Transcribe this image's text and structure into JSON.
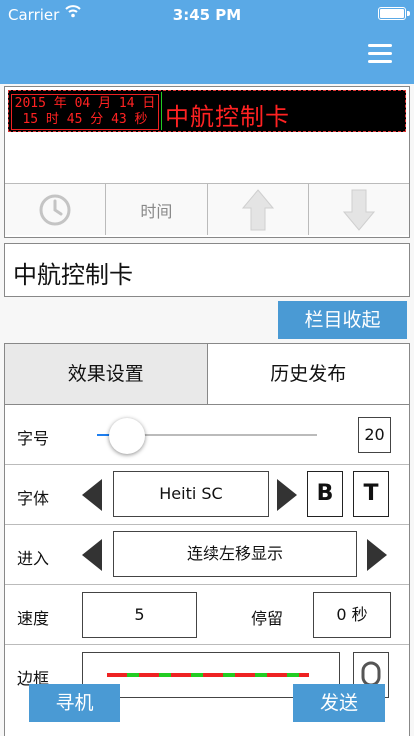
{
  "status_bar": {
    "carrier": "Carrier",
    "time": "3:45 PM"
  },
  "header": {
    "menu_icon": "hamburger-menu-icon"
  },
  "preview": {
    "date_line1": "2015 年 04 月 14 日",
    "date_line2": "15 时 45 分 43 秒",
    "led_title": "中航控制卡",
    "tools": [
      {
        "icon": "clock-icon"
      },
      {
        "label": "时间"
      },
      {
        "icon": "arrow-up-icon"
      },
      {
        "icon": "arrow-down-icon"
      }
    ]
  },
  "text_input": {
    "value": "中航控制卡"
  },
  "collapse_button": "栏目收起",
  "tabs": [
    {
      "label": "效果设置",
      "active": true
    },
    {
      "label": "历史发布",
      "active": false
    }
  ],
  "settings": {
    "font_size": {
      "label": "字号",
      "value": "20",
      "slider_fraction": 0.1
    },
    "font_face": {
      "label": "字体",
      "value": "Heiti SC",
      "bold_label": "B",
      "t_label": "T"
    },
    "enter": {
      "label": "进入",
      "value": "连续左移显示"
    },
    "speed": {
      "label": "速度",
      "value": "5",
      "stay_label": "停留",
      "stay_value": "0 秒"
    },
    "border": {
      "label": "边框"
    }
  },
  "buttons": {
    "search": "寻机",
    "send": "发送"
  },
  "colors": {
    "header": "#5aa9e6",
    "button": "#4a9ad4",
    "led_text": "#ff2222",
    "slider": "#1e7ff0"
  }
}
